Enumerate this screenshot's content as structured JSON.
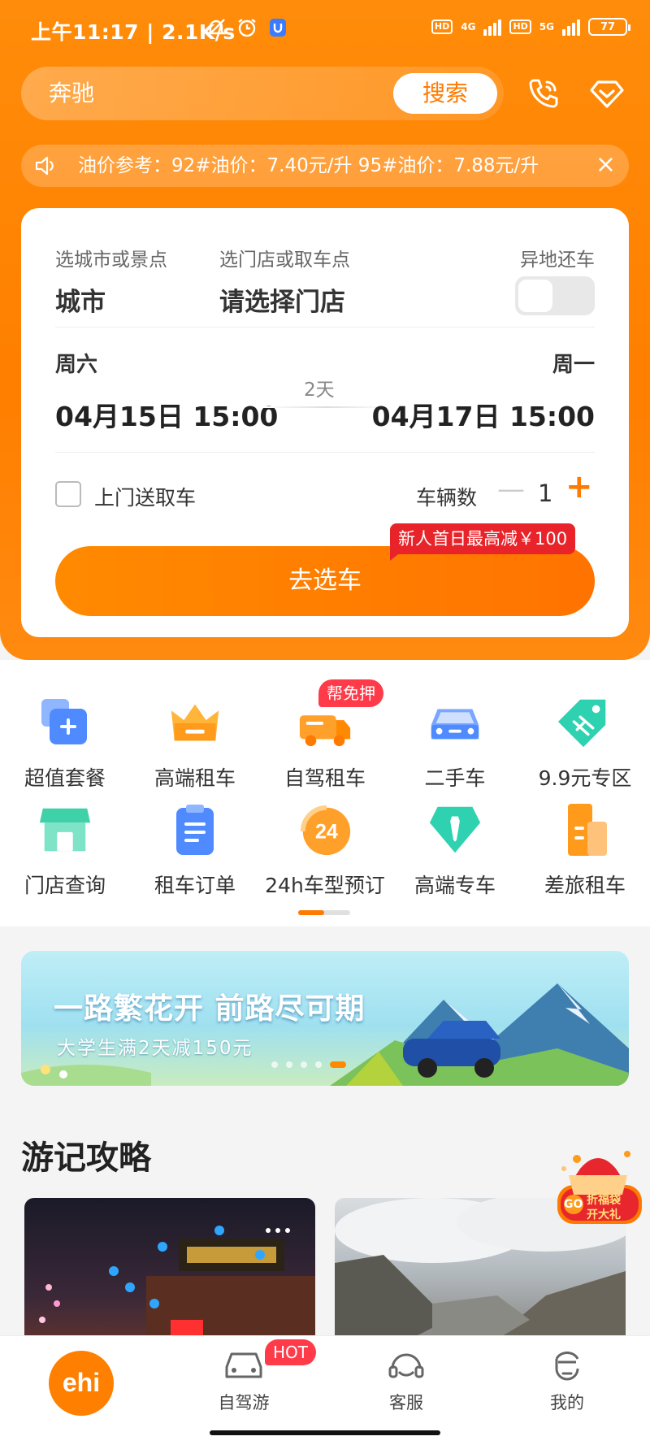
{
  "status_bar": {
    "time": "上午11:17 | 2.1K/s",
    "network_1": "4G",
    "network_2": "5G",
    "hd": "HD",
    "battery": "77"
  },
  "search": {
    "value": "奔驰",
    "button": "搜索"
  },
  "notice": {
    "text": "油价参考：92#油价：7.40元/升   95#油价：7.88元/升"
  },
  "booking": {
    "city_label": "选城市或景点",
    "city_value": "城市",
    "store_label": "选门店或取车点",
    "store_value": "请选择门店",
    "return_label": "异地还车",
    "pickup_day": "周六",
    "pickup_datetime": "04月15日 15:00",
    "duration": "2天",
    "return_day": "周一",
    "return_datetime": "04月17日 15:00",
    "door_delivery": "上门送取车",
    "vehicle_count_label": "车辆数",
    "minus": "—",
    "vehicle_count": "1",
    "plus": "+",
    "promo": "新人首日最高减￥100",
    "go_button": "去选车"
  },
  "grid": {
    "items": [
      {
        "label": "超值套餐",
        "icon": "package-icon"
      },
      {
        "label": "高端租车",
        "icon": "crown-icon"
      },
      {
        "label": "自驾租车",
        "icon": "truck-icon"
      },
      {
        "label": "二手车",
        "icon": "car-icon"
      },
      {
        "label": "9.9元专区",
        "icon": "tag-icon"
      },
      {
        "label": "门店查询",
        "icon": "store-icon"
      },
      {
        "label": "租车订单",
        "icon": "clipboard-icon"
      },
      {
        "label": "24h车型预订",
        "icon": "24h-icon"
      },
      {
        "label": "高端专车",
        "icon": "tie-icon"
      },
      {
        "label": "差旅租车",
        "icon": "building-icon"
      }
    ],
    "badge": "帮免押"
  },
  "banner": {
    "title": "一路繁花开 前路尽可期",
    "subtitle": "大学生满2天减150元"
  },
  "section": {
    "title": "游记攻略"
  },
  "gift": {
    "text1": "GO",
    "text2": "折福袋",
    "text3": "开大礼"
  },
  "tabbar": {
    "home_logo": "ehi",
    "tab2": "自驾游",
    "hot": "HOT",
    "tab3": "客服",
    "tab4": "我的"
  },
  "colors": {
    "brand": "#ff7f00",
    "badge_red": "#ff3b4a"
  }
}
